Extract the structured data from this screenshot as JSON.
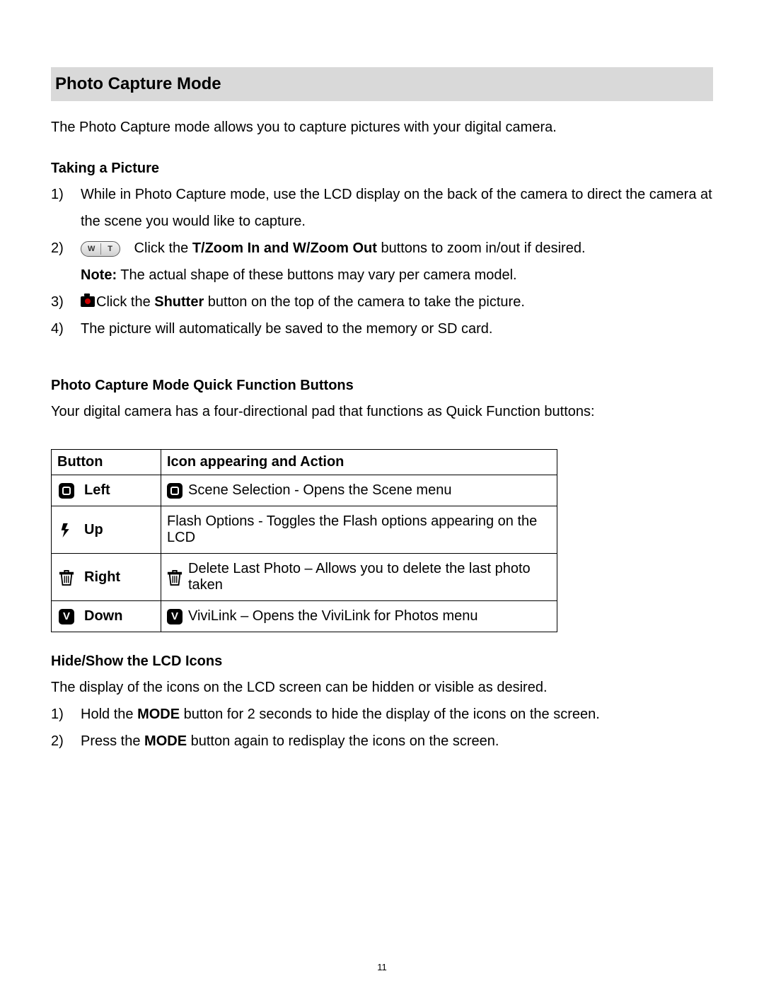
{
  "h1": "Photo Capture Mode",
  "intro": "The Photo Capture mode allows you to capture pictures with your digital camera.",
  "taking": {
    "heading": "Taking a Picture",
    "items": [
      {
        "num": "1)",
        "text": "While in Photo Capture mode, use the LCD display on the back of the camera to direct the camera at the scene you would like to capture."
      },
      {
        "num": "2)",
        "pre": " Click the ",
        "bold1": "T/Zoom In and W/Zoom Out",
        "post1": " buttons to zoom in/out if desired.",
        "note_label": "Note:",
        "note_text": " The actual shape of these buttons may vary per camera model."
      },
      {
        "num": "3)",
        "pre": "Click the ",
        "bold1": "Shutter",
        "post1": " button on the top of the camera to take the picture."
      },
      {
        "num": "4)",
        "text": "The picture will automatically be saved to the memory or SD card."
      }
    ]
  },
  "quick": {
    "heading": "Photo Capture Mode Quick Function Buttons",
    "intro": "Your digital camera has a four-directional pad that functions as Quick Function buttons:",
    "th_button": "Button",
    "th_action": "Icon appearing and Action",
    "rows": [
      {
        "dir": "Left",
        "action": "Scene Selection - Opens the Scene menu"
      },
      {
        "dir": "Up",
        "action": "Flash Options - Toggles the Flash options appearing on the LCD"
      },
      {
        "dir": "Right",
        "action": " Delete Last Photo – Allows you to delete the last photo taken"
      },
      {
        "dir": "Down",
        "action": " ViviLink – Opens the ViviLink for Photos menu"
      }
    ]
  },
  "hide": {
    "heading": "Hide/Show the LCD Icons",
    "intro": "The display of the icons on the LCD screen can be hidden or visible as desired.",
    "items": [
      {
        "num": "1)",
        "pre": "Hold the ",
        "bold1": "MODE",
        "post1": " button for 2 seconds to hide the display of the icons on the screen."
      },
      {
        "num": "2)",
        "pre": "Press the ",
        "bold1": "MODE",
        "post1": " button again to redisplay the icons on the screen."
      }
    ]
  },
  "page_number": "11"
}
